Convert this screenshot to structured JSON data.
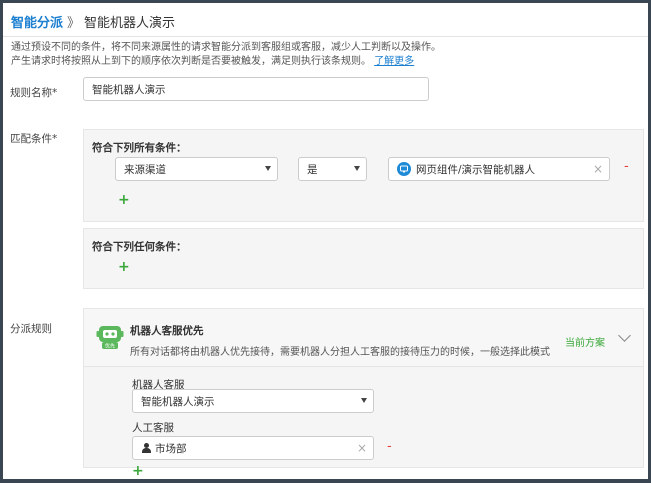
{
  "breadcrumb": {
    "root": "智能分派",
    "separator": "》",
    "current": "智能机器人演示"
  },
  "description": {
    "line1": "通过预设不同的条件，将不同来源属性的请求智能分派到客服组或客服，减少人工判断以及操作。",
    "line2": "产生请求时将按照从上到下的顺序依次判断是否要被触发，满足则执行该条规则。",
    "learn_more": "了解更多"
  },
  "rule_name": {
    "label": "规则名称*",
    "value": "智能机器人演示"
  },
  "match": {
    "label": "匹配条件*",
    "all_title": "符合下列所有条件：",
    "any_title": "符合下列任何条件：",
    "condition": {
      "field": "来源渠道",
      "operator": "是",
      "value": "网页组件/演示智能机器人",
      "clear": "×",
      "remove": "-"
    },
    "add": "+"
  },
  "dispatch": {
    "label": "分派规则",
    "strategy_title": "机器人客服优先",
    "strategy_desc": "所有对话都将由机器人优先接待，需要机器人分担人工客服的接待压力的时候，一般选择此模式",
    "current_plan": "当前方案",
    "bot_badge": "优先",
    "robot_label": "机器人客服",
    "robot_value": "智能机器人演示",
    "human_label": "人工客服",
    "human_value": "市场部",
    "clear": "×",
    "remove": "-",
    "add": "+"
  },
  "colors": {
    "link": "#1c7fd0",
    "green": "#3aa83a",
    "red": "#e04040",
    "bot_green": "#5cb85c"
  }
}
